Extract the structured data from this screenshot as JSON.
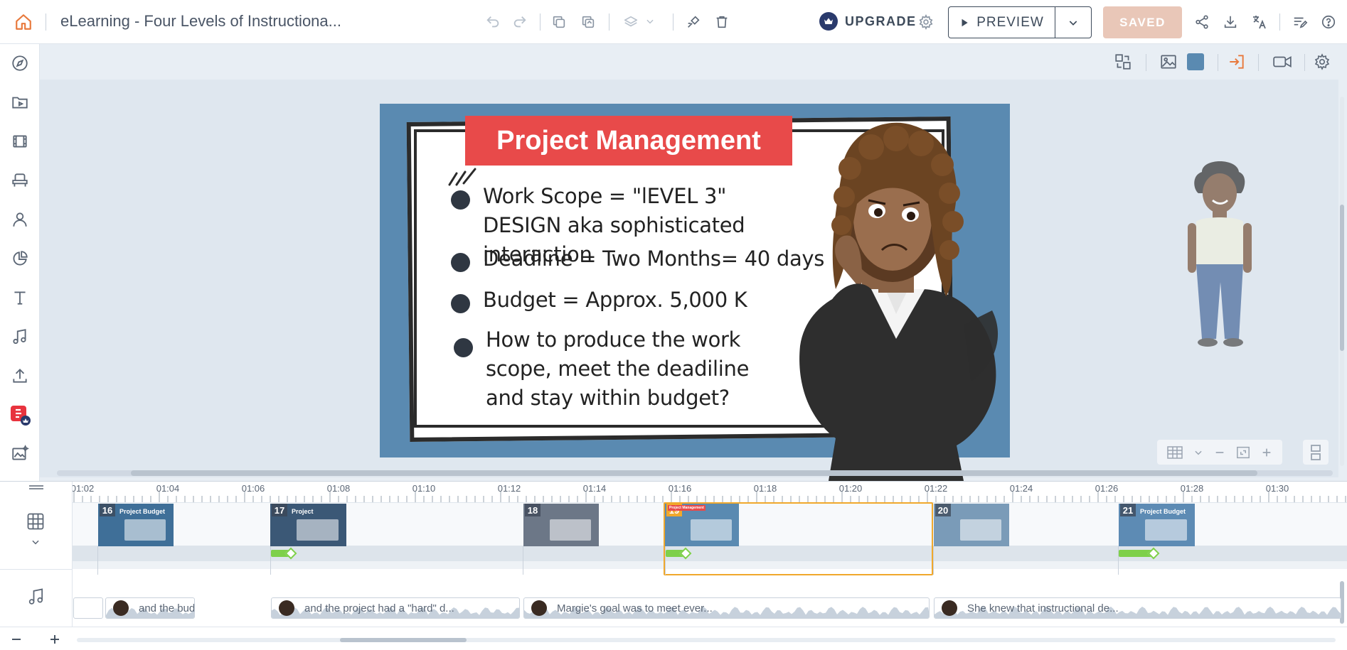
{
  "header": {
    "title": "eLearning - Four Levels of Instructiona...",
    "upgrade_label": "UPGRADE",
    "preview_label": "PREVIEW",
    "saved_label": "SAVED"
  },
  "slide": {
    "title": "Project Management",
    "bullets": [
      "Work Scope = \"lEVEL 3\" DESIGN aka sophisticated interaction",
      "Deadline = Two Months= 40 days",
      "Budget = Approx. 5,000 K",
      "How to produce the work scope, meet the deadiline and stay within budget?"
    ]
  },
  "timeline": {
    "ticks": [
      "01:02",
      "01:04",
      "01:06",
      "01:08",
      "01:10",
      "01:12",
      "01:14",
      "01:16",
      "01:18",
      "01:20",
      "01:22",
      "01:24",
      "01:26",
      "01:28",
      "01:30"
    ],
    "scenes": [
      {
        "number": "16",
        "thumb_title": "Project Budget"
      },
      {
        "number": "17",
        "thumb_title": "Project"
      },
      {
        "number": "18",
        "thumb_title": ""
      },
      {
        "number": "19",
        "thumb_title": "Project Management"
      },
      {
        "number": "20",
        "thumb_title": ""
      },
      {
        "number": "21",
        "thumb_title": "Project Budget"
      }
    ],
    "audio_clips": [
      "and the bud",
      "and the project had a \"hard\" d...",
      "Margie's goal was to meet ever...",
      "She knew that instructional de..."
    ]
  },
  "colors": {
    "accent_orange": "#f0a82c",
    "title_red": "#e84a4a",
    "slide_blue": "#5a8ab1",
    "saved_bg": "#e9c7b8",
    "transition_green": "#7ed04a"
  }
}
